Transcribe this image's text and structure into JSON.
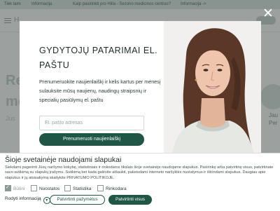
{
  "background": {
    "topbar": {
      "left_link_1": "Tiek laim",
      "left_link_2": "Informacija",
      "center_text": "Kaip pasirinkti pro Hilla - Sezono medicinos centras?",
      "right_text": "Informacija ->"
    },
    "header": {
      "logo_fragment": "H"
    },
    "left_fragments": [
      "Re",
      "me",
      "Jus"
    ],
    "right_fragments": [
      "Jau",
      "Per"
    ]
  },
  "modal": {
    "title": "GYDYTOJŲ PATARIMAI EL. PAŠTU",
    "body": "Prenumeruokite naujienlaiškį ir kelis kartus per mėnesį sulauksite mūsų naujienų, naudingų straipsnių ir specialių pasiūlymų el. paštu",
    "email_placeholder": "El. pašto adresas",
    "email_value": "",
    "subscribe_label": "Prenumeruoti naujienlaiškį",
    "close_icon": "close-icon"
  },
  "cookie_banner": {
    "title": "Šioje svetainėje naudojami slapukai",
    "text": "Siekdami pagerinti Jūsų naršymo kokybę, statistiniais ir rinkodaros tikslais šioje svetainėje naudojame slapukus. Pasirinkę arba patvirtinę visus, patvirtinate savo sutikimą su slapukų įrašymu. Sutikimą bet kada galėsite atšaukti, pakeisdami interneto naršyklės nustatymus ir ištrindami slapukus. Daugiau apie slapukus ir jų atsisakymą skaitykite PRIVATUMO POLITIKOJE.",
    "options": [
      {
        "label": "Būtini",
        "checked": true,
        "disabled": true
      },
      {
        "label": "Nuostatos",
        "checked": false,
        "disabled": false
      },
      {
        "label": "Statistika",
        "checked": false,
        "disabled": false
      },
      {
        "label": "Rinkodara",
        "checked": false,
        "disabled": false
      }
    ],
    "details_label": "Rodyti informaciją",
    "confirm_selected_label": "Patvirtinti pažymėtus",
    "confirm_all_label": "Patvirtinti visus"
  },
  "colors": {
    "primary": "#1f5646",
    "overlay": "#232d2a",
    "topbar_bg": "#dde8e3"
  }
}
